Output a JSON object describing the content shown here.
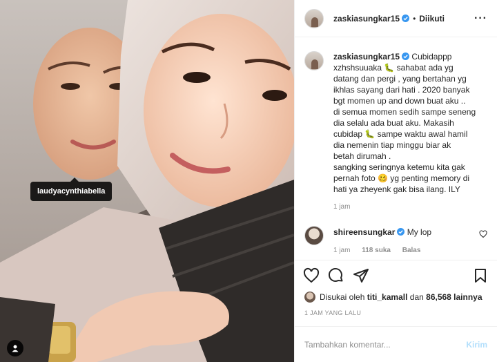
{
  "photo": {
    "tag_label": "laudyacynthiabella"
  },
  "header": {
    "username": "zaskiasungkar15",
    "separator": "•",
    "follow_state": "Diikuti",
    "more_label": "···"
  },
  "caption": {
    "username": "zaskiasungkar15",
    "text": "Cubidappp\nxzhshsuuaka 🐛 sahabat ada yg\ndatang dan pergi , yang bertahan yg\nikhlas sayang dari hati . 2020 banyak\nbgt momen up and down buat aku ..\ndi semua momen sedih sampe seneng\ndia selalu ada buat aku. Makasih\ncubidap 🐛 sampe waktu awal hamil\ndia nemenin tiap minggu biar ak\nbetah dirumah .\nsangking seringnya ketemu kita gak\npernah foto 🥴 yg penting memory di\nhati ya zheyenk gak bisa ilang. ILY",
    "time": "1 jam"
  },
  "comment": {
    "username": "shireensungkar",
    "text": "My lop",
    "time": "1 jam",
    "likes": "118 suka",
    "reply": "Balas"
  },
  "likes": {
    "prefix": "Disukai oleh",
    "user": "titi_kamall",
    "middle": "dan",
    "count": "86,568 lainnya"
  },
  "timeago": "1 JAM YANG LALU",
  "add_comment": {
    "placeholder": "Tambahkan komentar...",
    "post_label": "Kirim"
  },
  "colors": {
    "verified": "#3897f0",
    "post_disabled": "#b2dffc",
    "muted": "#8e8e8e"
  }
}
